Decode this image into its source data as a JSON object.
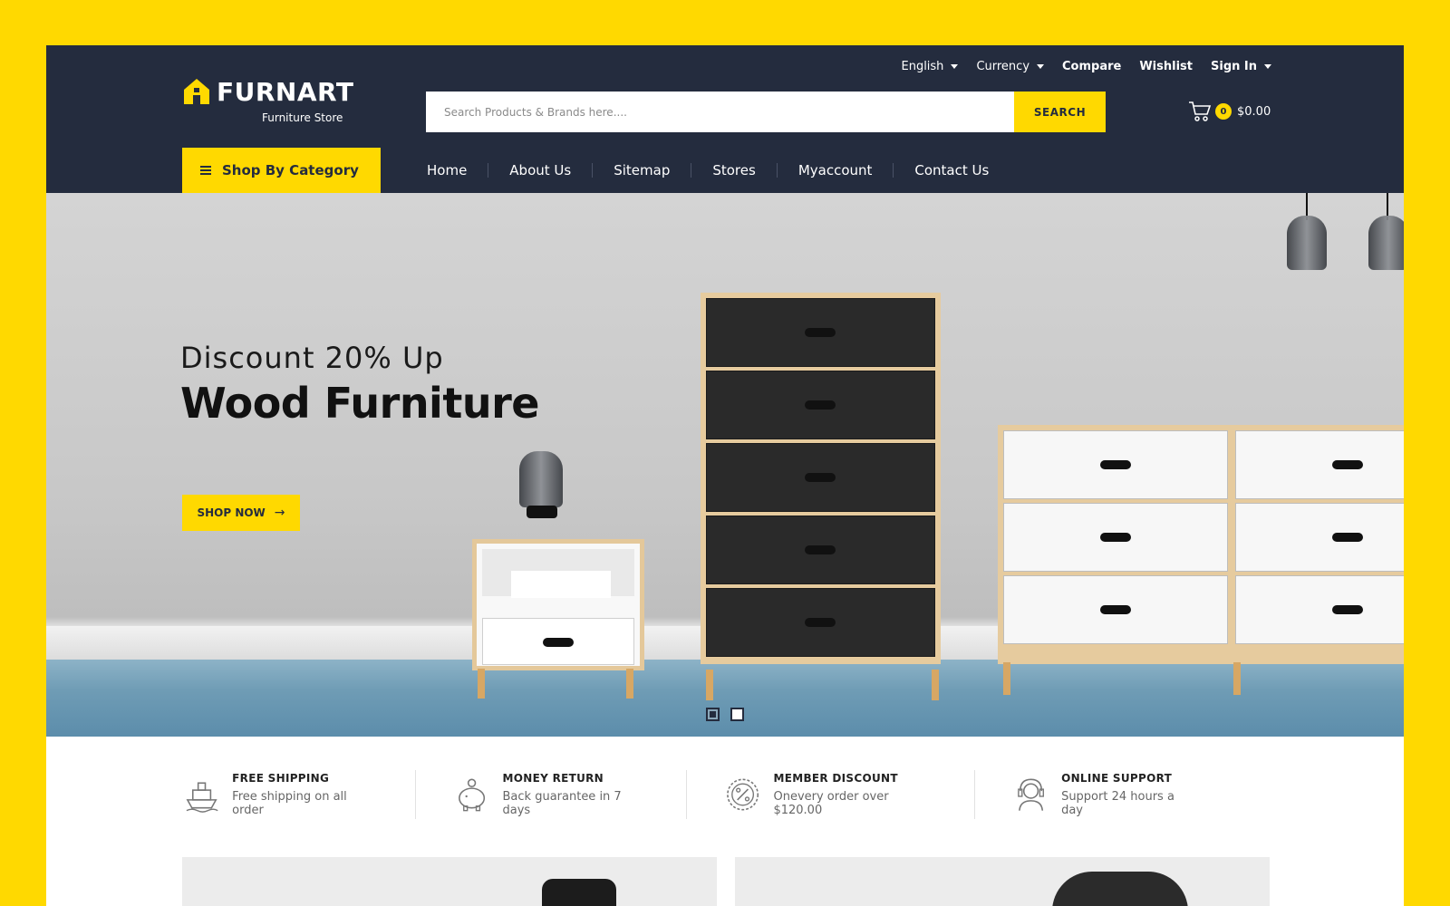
{
  "brand": {
    "name": "FURNART",
    "tagline": "Furniture Store"
  },
  "topbar": {
    "language": "English",
    "currency": "Currency",
    "compare": "Compare",
    "wishlist": "Wishlist",
    "signin": "Sign In"
  },
  "search": {
    "placeholder": "Search Products & Brands here....",
    "button": "SEARCH"
  },
  "cart": {
    "count": "0",
    "total": "$0.00"
  },
  "nav": {
    "category_button": "Shop By Category",
    "items": [
      "Home",
      "About Us",
      "Sitemap",
      "Stores",
      "Myaccount",
      "Contact Us"
    ]
  },
  "hero": {
    "subtitle": "Discount 20% Up",
    "title": "Wood Furniture",
    "cta": "SHOP NOW",
    "slides": 2,
    "active_slide": 1
  },
  "features": [
    {
      "title": "FREE SHIPPING",
      "desc": "Free shipping on all order",
      "icon": "ship-icon"
    },
    {
      "title": "MONEY RETURN",
      "desc": "Back guarantee in 7 days",
      "icon": "piggy-bank-icon"
    },
    {
      "title": "MEMBER DISCOUNT",
      "desc": "Onevery order over $120.00",
      "icon": "discount-badge-icon"
    },
    {
      "title": "ONLINE SUPPORT",
      "desc": "Support 24 hours a day",
      "icon": "headset-icon"
    }
  ],
  "colors": {
    "accent": "#FFD900",
    "header": "#242c3e",
    "background": "#ffffff"
  }
}
